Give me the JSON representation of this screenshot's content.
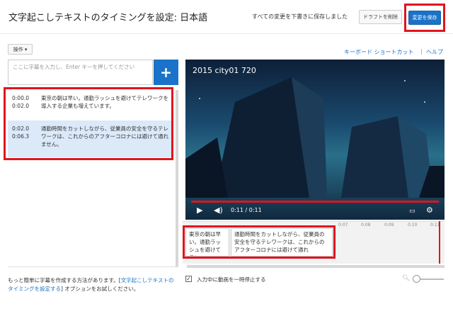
{
  "header": {
    "title": "文字起こしテキストのタイミングを設定: 日本語",
    "save_status": "すべての変更を下書きに保存しました",
    "discard_label": "ドラフトを削除",
    "save_label": "変更を保存"
  },
  "toolbar": {
    "actions_label": "操作 ▾",
    "shortcuts_link": "キーボード ショートカット",
    "separator": "|",
    "help_link": "ヘルプ"
  },
  "caption_input": {
    "placeholder": "ここに字幕を入力し、Enter キーを押してください",
    "add_label": "+"
  },
  "captions": [
    {
      "start": "0:00.0",
      "end": "0:02.0",
      "text": "東京の朝は早い。通勤ラッシュを避けてテレワークを導入する企業も増えています。"
    },
    {
      "start": "0:02.0",
      "end": "0:06.3",
      "text": "通勤時間をカットしながら、従業員の安全を守るテレワークは、これからのアフターコロナには避けて通れません。"
    }
  ],
  "bottom_note": {
    "before": "もっと簡単に字幕を作成する方法があります。[",
    "link": "文字起こしテキストのタイミングを設定する",
    "after": "] オプションをお試しください。"
  },
  "video": {
    "title": "2015 city01 720",
    "time": "0:11 / 0:11",
    "progress": 1.0,
    "icons": [
      "play-icon",
      "volume-icon",
      "subtitles-icon",
      "settings-icon"
    ]
  },
  "timeline": {
    "ticks": [
      "0:07",
      "0:08",
      "0:09",
      "0:10",
      "0:11"
    ],
    "cues": [
      "東京の朝は早い。通勤ラッシュを避けてテレ",
      "通勤時間をカットしながら、従業員の安全を守るテレワークは、これからのアフターコロナには避けて通れ"
    ]
  },
  "options": {
    "pause_label": "入力中に動画を一時停止する",
    "pause_checked": "✓"
  },
  "colors": {
    "accent_blue": "#1a73c8",
    "highlight_red": "#e0141e",
    "selected_row": "#dbe9f9"
  }
}
